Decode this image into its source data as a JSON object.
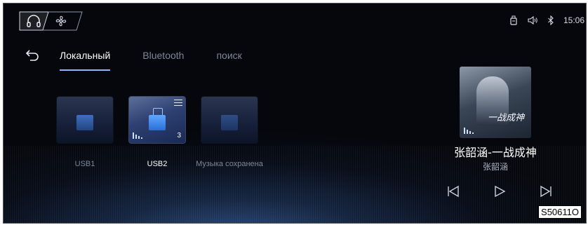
{
  "status_bar": {
    "icons": [
      "usb-drive-icon",
      "volume-icon",
      "bluetooth-icon"
    ],
    "clock": "15:06"
  },
  "mode_tabs": [
    "music-icon",
    "fan-icon"
  ],
  "tabs": [
    {
      "label": "Локальный",
      "active": true
    },
    {
      "label": "Bluetooth",
      "active": false
    },
    {
      "label": "поиск",
      "active": false
    }
  ],
  "sources": [
    {
      "label": "USB1",
      "active": false
    },
    {
      "label": "USB2",
      "active": true,
      "count": "3"
    },
    {
      "label": "Музыка сохранена",
      "active": false
    }
  ],
  "now_playing": {
    "title": "张韶涵-一战成神",
    "artist": "张韶涵",
    "album_art_text": "一战成神"
  },
  "controls": [
    "previous-icon",
    "play-icon",
    "next-icon"
  ],
  "watermark": "S50611O",
  "colors": {
    "accent": "#8fb5ff",
    "background": "#05070c"
  }
}
